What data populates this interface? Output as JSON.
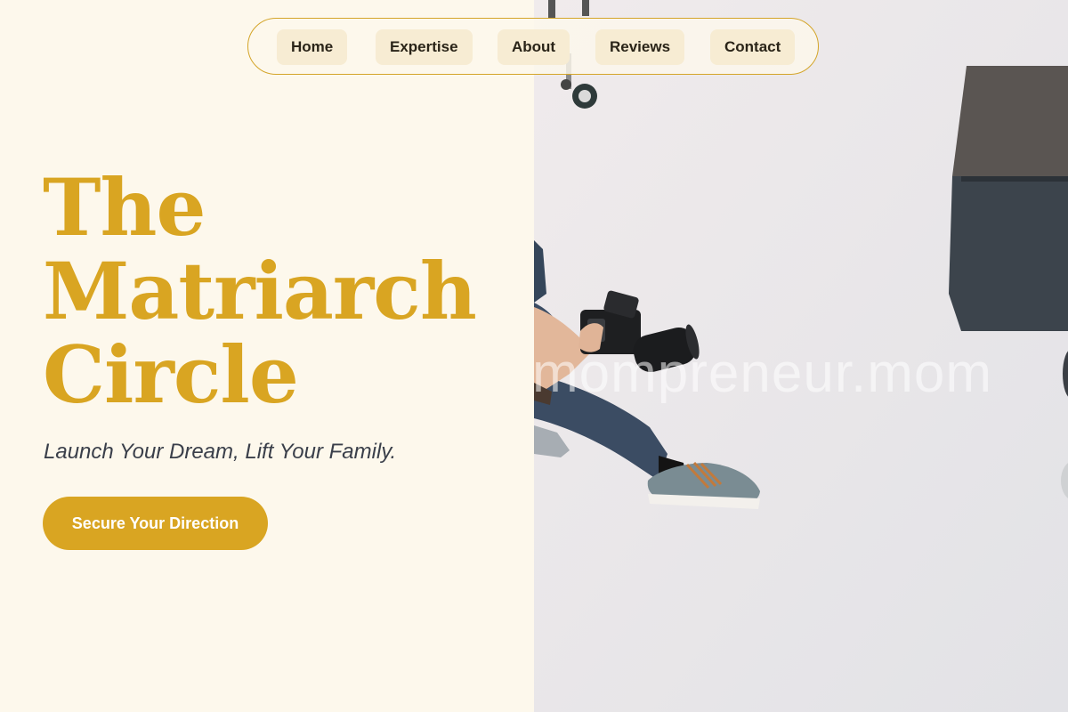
{
  "nav": {
    "items": [
      {
        "label": "Home"
      },
      {
        "label": "Expertise"
      },
      {
        "label": "About"
      },
      {
        "label": "Reviews"
      },
      {
        "label": "Contact"
      }
    ]
  },
  "hero": {
    "title_lines": [
      "The",
      "Matriarch",
      "Circle"
    ],
    "tagline": "Launch Your Dream, Lift Your Family.",
    "cta_label": "Secure Your Direction"
  },
  "image": {
    "watermark": "mompreneur.mom"
  },
  "colors": {
    "accent": "#d9a522",
    "background": "#fdf8ec",
    "nav_pill": "#f7ecd3",
    "text_dark": "#2a2418",
    "tagline": "#3a3f4a"
  }
}
